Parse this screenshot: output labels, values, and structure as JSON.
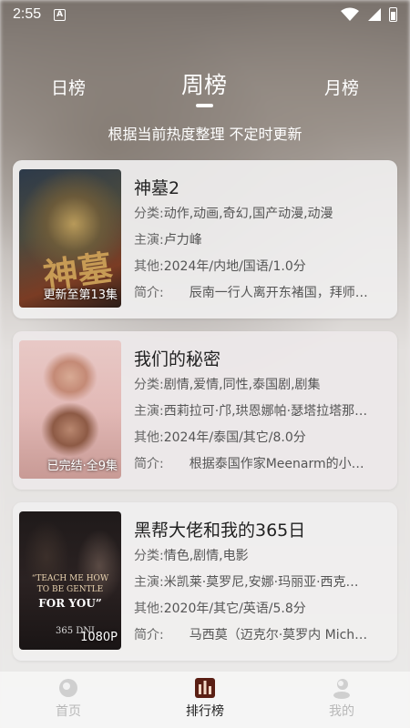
{
  "status_bar": {
    "time": "2:55"
  },
  "tabs": [
    {
      "label": "日榜",
      "active": false
    },
    {
      "label": "周榜",
      "active": true
    },
    {
      "label": "月榜",
      "active": false
    }
  ],
  "subtitle": "根据当前热度整理 不定时更新",
  "items": [
    {
      "title": "神墓2",
      "badge": "更新至第13集",
      "genre_key": "分类:",
      "genre": "动作,动画,奇幻,国产动漫,动漫",
      "cast_key": "主演:",
      "cast": "卢力峰",
      "other_key": "其他:",
      "other": "2024年/内地/国语/1.0分",
      "intro_key": "简介:",
      "intro": "辰南一行人离开东褚国，拜师…",
      "poster_text": "神墓"
    },
    {
      "title": "我们的秘密",
      "badge": "已完结·全9集",
      "genre_key": "分类:",
      "genre": "剧情,爱情,同性,泰国剧,剧集",
      "cast_key": "主演:",
      "cast": "西莉拉可·邝,珙恩娜帕·瑟塔拉塔那…",
      "other_key": "其他:",
      "other": "2024年/泰国/其它/8.0分",
      "intro_key": "简介:",
      "intro": "根据泰国作家Meenarm的小…"
    },
    {
      "title": "黑帮大佬和我的365日",
      "badge": "1080P",
      "genre_key": "分类:",
      "genre": "情色,剧情,电影",
      "cast_key": "主演:",
      "cast": "米凯莱·莫罗尼,安娜·玛丽亚·西克…",
      "other_key": "其他:",
      "other": "2020年/其它/英语/5.8分",
      "intro_key": "简介:",
      "intro": "马西莫（迈克尔·莫罗内 Mich…",
      "poster_quote": "“TEACH ME HOW TO BE GENTLE",
      "poster_for": "FOR YOU”",
      "poster_365": "365 DNI"
    }
  ],
  "bottom_nav": [
    {
      "label": "首页",
      "icon": "home-icon",
      "active": false
    },
    {
      "label": "排行榜",
      "icon": "ranking-icon",
      "active": true
    },
    {
      "label": "我的",
      "icon": "profile-icon",
      "active": false
    }
  ],
  "colors": {
    "accent": "#5a1f14",
    "inactive": "#b8b8b8"
  }
}
